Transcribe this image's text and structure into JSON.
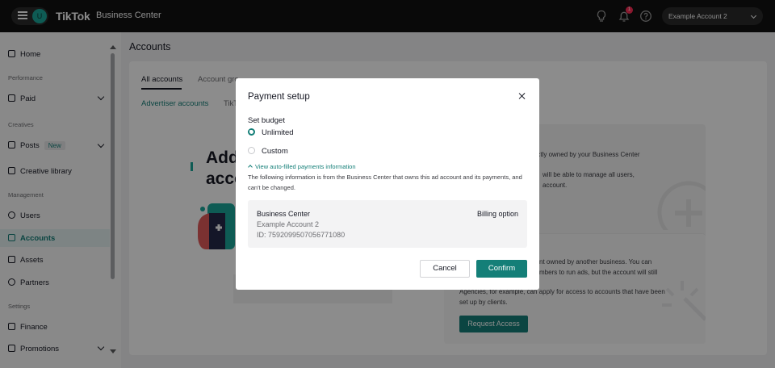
{
  "topbar": {
    "avatar_letter": "U",
    "logo": "TikTok",
    "logo_sub": "Business Center",
    "notification_count": "1",
    "account_name": "Example Account 2"
  },
  "sidebar": {
    "home": "Home",
    "section_performance": "Performance",
    "paid": "Paid",
    "section_creatives": "Creatives",
    "posts": "Posts",
    "posts_badge": "New",
    "creative_library": "Creative library",
    "section_management": "Management",
    "users": "Users",
    "accounts": "Accounts",
    "assets": "Assets",
    "partners": "Partners",
    "section_settings": "Settings",
    "finance": "Finance",
    "promotions": "Promotions"
  },
  "main": {
    "page_title": "Accounts",
    "tabs": [
      "All accounts",
      "Account gro"
    ],
    "subtabs": [
      "Advertiser accounts",
      "TikT"
    ],
    "hero_line1": "Add",
    "hero_line2": "acco",
    "panel_text_1": "directly owned by your Business Center",
    "panel_text_2": "will be able to manage all users,",
    "panel_text_3": "account.",
    "panel_text_4": "nt owned by another business. You can",
    "panel_text_5": "mbers to run ads, but the account will still",
    "panel_text_6": "Agencies, for example, can apply for access to accounts that have been",
    "panel_text_7": "set up by clients.",
    "request_access": "Request Access"
  },
  "modal": {
    "title": "Payment setup",
    "set_budget": "Set budget",
    "option_unlimited": "Unlimited",
    "option_custom": "Custom",
    "link": "View auto-filled payments information",
    "info": "The following information is from the Business Center that owns this ad account and its payments, and can't be changed.",
    "bc_label": "Business Center",
    "bc_name": "Example Account 2",
    "bc_id": "ID: 7592099507056771080",
    "billing": "Billing option",
    "cancel": "Cancel",
    "confirm": "Confirm"
  },
  "colors": {
    "accent": "#147f78",
    "topbar": "#121212",
    "badge": "#fe2c55"
  }
}
